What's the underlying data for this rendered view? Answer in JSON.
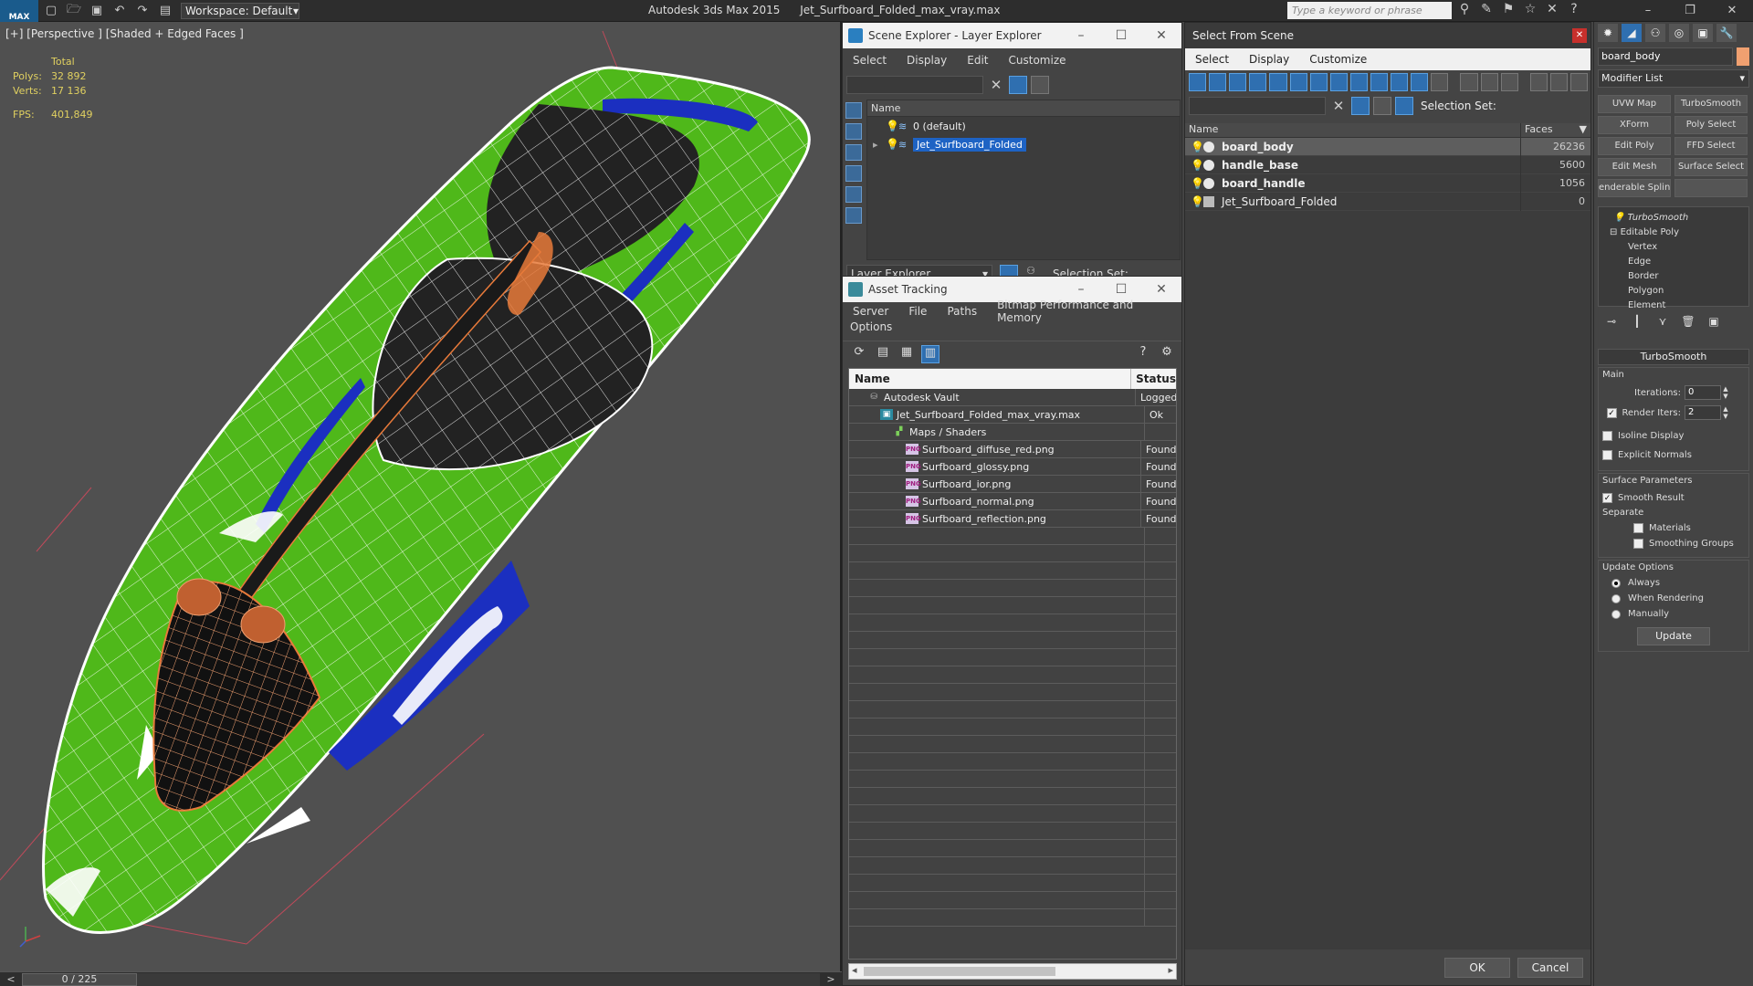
{
  "titlebar": {
    "logo": "MAX",
    "workspace_label": "Workspace: Default",
    "app_name": "Autodesk 3ds Max  2015",
    "file_name": "Jet_Surfboard_Folded_max_vray.max",
    "search_placeholder": "Type a keyword or phrase"
  },
  "viewport": {
    "label": "[+] [Perspective ] [Shaded + Edged Faces ]",
    "stats": {
      "total_label": "Total",
      "polys_label": "Polys:",
      "polys_value": "32 892",
      "verts_label": "Verts:",
      "verts_value": "17 136",
      "fps_label": "FPS:",
      "fps_value": "401,849"
    }
  },
  "timeline": {
    "frame": "0 / 225",
    "prev": "<",
    "next": ">"
  },
  "scene_explorer": {
    "title": "Scene Explorer - Layer Explorer",
    "menu": [
      "Select",
      "Display",
      "Edit",
      "Customize"
    ],
    "column_name": "Name",
    "layers": [
      {
        "name": "0 (default)",
        "selected": false
      },
      {
        "name": "Jet_Surfboard_Folded",
        "selected": true
      }
    ],
    "footer_dropdown": "Layer Explorer",
    "selection_set_label": "Selection Set:"
  },
  "asset_tracking": {
    "title": "Asset Tracking",
    "menu": [
      "Server",
      "File",
      "Paths",
      "Bitmap Performance and Memory"
    ],
    "menu2": "Options",
    "columns": {
      "name": "Name",
      "status": "Status"
    },
    "rows": [
      {
        "name": "Autodesk Vault",
        "status": "Logged",
        "indent": 20,
        "icon": "vault"
      },
      {
        "name": "Jet_Surfboard_Folded_max_vray.max",
        "status": "Ok",
        "indent": 34,
        "icon": "max"
      },
      {
        "name": "Maps / Shaders",
        "status": "",
        "indent": 48,
        "icon": "maps"
      },
      {
        "name": "Surfboard_diffuse_red.png",
        "status": "Found",
        "indent": 62,
        "icon": "png"
      },
      {
        "name": "Surfboard_glossy.png",
        "status": "Found",
        "indent": 62,
        "icon": "png"
      },
      {
        "name": "Surfboard_ior.png",
        "status": "Found",
        "indent": 62,
        "icon": "png"
      },
      {
        "name": "Surfboard_normal.png",
        "status": "Found",
        "indent": 62,
        "icon": "png"
      },
      {
        "name": "Surfboard_reflection.png",
        "status": "Found",
        "indent": 62,
        "icon": "png"
      }
    ],
    "empty_row_count": 23
  },
  "select_from_scene": {
    "title": "Select From Scene",
    "menu": [
      "Select",
      "Display",
      "Customize"
    ],
    "selection_set_label": "Selection Set:",
    "columns": {
      "name": "Name",
      "faces": "Faces"
    },
    "objects": [
      {
        "name": "board_body",
        "faces": "26236",
        "selected": true,
        "bold": true,
        "kind": "object"
      },
      {
        "name": "handle_base",
        "faces": "5600",
        "selected": false,
        "bold": true,
        "kind": "object"
      },
      {
        "name": "board_handle",
        "faces": "1056",
        "selected": false,
        "bold": true,
        "kind": "object"
      },
      {
        "name": "Jet_Surfboard_Folded",
        "faces": "0",
        "selected": false,
        "bold": false,
        "kind": "group"
      }
    ],
    "ok_label": "OK",
    "cancel_label": "Cancel"
  },
  "command_panel": {
    "object_name": "board_body",
    "object_color": "#f0a070",
    "modifier_list": "Modifier List",
    "modifier_buttons": [
      "UVW Map",
      "TurboSmooth",
      "XForm",
      "Poly Select",
      "Edit Poly",
      "FFD Select",
      "Edit Mesh",
      "Surface Select",
      "enderable Splin",
      ""
    ],
    "stack": {
      "turbosmooth": "TurboSmooth",
      "editable_poly": "Editable Poly",
      "subobjects": [
        "Vertex",
        "Edge",
        "Border",
        "Polygon",
        "Element"
      ]
    },
    "turbosmooth": {
      "title": "TurboSmooth",
      "main_label": "Main",
      "iterations_label": "Iterations:",
      "iterations_value": "0",
      "render_iters_label": "Render Iters:",
      "render_iters_value": "2",
      "render_iters_checked": true,
      "isoline_label": "Isoline Display",
      "explicit_normals_label": "Explicit Normals",
      "surface_params_label": "Surface Parameters",
      "smooth_result_label": "Smooth Result",
      "separate_label": "Separate",
      "materials_label": "Materials",
      "smoothing_groups_label": "Smoothing Groups",
      "update_options_label": "Update Options",
      "always_label": "Always",
      "when_rendering_label": "When Rendering",
      "manually_label": "Manually",
      "update_button": "Update"
    }
  },
  "colors": {
    "board_green": "#4fb81a",
    "board_blue": "#1b2fc0",
    "wire_orange": "#e87a3a",
    "selection_blue": "#1e63c4"
  }
}
